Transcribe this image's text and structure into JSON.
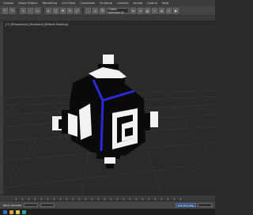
{
  "menu": [
    "Graphs",
    "Graph Editors",
    "Rendering",
    "Civil View",
    "Customize",
    "Scripting",
    "Content",
    "Arnold",
    "Corona",
    "Help"
  ],
  "toolbar": {
    "view_select": "Create Selection Se",
    "icons": [
      "undo-icon",
      "redo-icon",
      "link-icon",
      "unlink-icon",
      "bind-icon",
      "select-icon",
      "select-region-icon",
      "move-icon",
      "rotate-icon",
      "scale-icon",
      "snap-icon",
      "angle-snap-icon",
      "percent-snap-icon",
      "mirror-icon",
      "align-icon",
      "layer-icon",
      "curve-editor-icon",
      "material-editor-icon",
      "render-setup-icon",
      "render-icon"
    ]
  },
  "viewport": {
    "label": "[+] [Perspective] [Standard] [Default Shading]",
    "colors": {
      "background": "#2a2a2a",
      "grid": "#3c3c3c",
      "model_white": "#f2f2f2",
      "model_black": "#0a0a0a",
      "accent_blue": "#2a2ad8"
    }
  },
  "status": {
    "selected": "None Selected",
    "chip": "Add Time Tag"
  },
  "taskbar": {
    "icons": [
      "start-icon",
      "browser-icon",
      "folder-icon",
      "app-icon"
    ]
  }
}
